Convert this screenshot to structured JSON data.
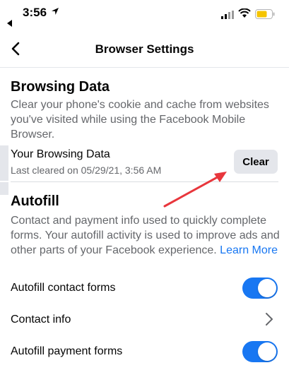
{
  "status_bar": {
    "time": "3:56",
    "icons": [
      "location-arrow-icon",
      "signal-icon",
      "wifi-icon",
      "battery-icon"
    ]
  },
  "nav": {
    "title": "Browser Settings",
    "back_icon": "chevron-left-icon"
  },
  "browsing_data": {
    "heading": "Browsing Data",
    "description": "Clear your phone's cookie and cache from websites you've visited while using the Facebook Mobile Browser.",
    "row_title": "Your Browsing Data",
    "row_subtitle": "Last cleared on 05/29/21, 3:56 AM",
    "clear_label": "Clear"
  },
  "autofill": {
    "heading": "Autofill",
    "description": "Contact and payment info used to quickly complete forms. Your autofill activity is used to improve ads and other parts of your Facebook experience.",
    "learn_more": "Learn More",
    "items": [
      {
        "label": "Autofill contact forms",
        "control": "toggle",
        "on": true
      },
      {
        "label": "Contact info",
        "control": "chevron"
      },
      {
        "label": "Autofill payment forms",
        "control": "toggle",
        "on": true
      }
    ]
  },
  "colors": {
    "accent": "#1877f2",
    "annotation_arrow": "#e8363c",
    "secondary_text": "#65676b",
    "button_bg": "#e4e6eb"
  }
}
